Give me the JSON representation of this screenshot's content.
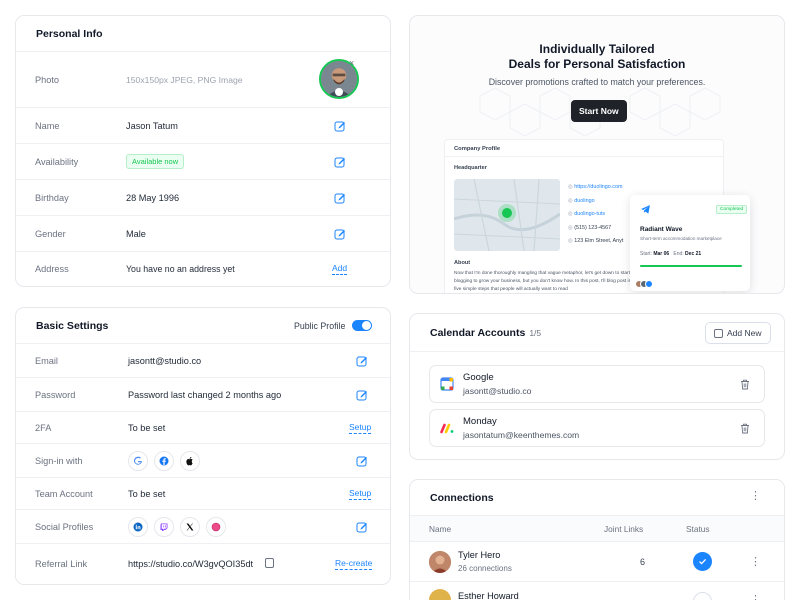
{
  "personal": {
    "title": "Personal Info",
    "photo_label": "Photo",
    "photo_hint": "150x150px JPEG, PNG Image",
    "name_label": "Name",
    "name_value": "Jason Tatum",
    "availability_label": "Availability",
    "availability_value": "Available now",
    "birthday_label": "Birthday",
    "birthday_value": "28 May 1996",
    "gender_label": "Gender",
    "gender_value": "Male",
    "address_label": "Address",
    "address_value": "You have no an address yet",
    "add_label": "Add"
  },
  "basic": {
    "title": "Basic Settings",
    "public_label": "Public Profile",
    "email_label": "Email",
    "email_value": "jasontt@studio.co",
    "password_label": "Password",
    "password_value": "Password last changed 2 months ago",
    "twofa_label": "2FA",
    "twofa_value": "To be set",
    "setup_label": "Setup",
    "signin_label": "Sign-in with",
    "team_label": "Team Account",
    "team_value": "To be set",
    "social_label": "Social Profiles",
    "referral_label": "Referral Link",
    "referral_value": "https://studio.co/W3gvQOI35dt",
    "recreate_label": "Re-create"
  },
  "promo": {
    "title_line1": "Individually Tailored",
    "title_line2": "Deals for Personal Satisfaction",
    "subtitle": "Discover promotions crafted to match your preferences.",
    "cta": "Start Now",
    "company_profile": "Company Profile",
    "headquarter": "Headquarter",
    "url": "https://duolingo.com",
    "handle1": "duolingo",
    "handle2": "duolingo-tuts",
    "phone": "(515) 123-4567",
    "street": "123 Elm Street, Anyt",
    "about": "About",
    "about_text": "Now that I'm done thoroughly mangling that vague metaphor, let's get down to start blogging to grow your business, but you don't know how. In this post, I'll blog post in five simple steps that people will actually want to read",
    "completed": "Completed",
    "project_name": "Radiant Wave",
    "project_desc": "Short-term accommodation marketplace",
    "start_label": "Start:",
    "start_value": "Mar 06",
    "end_label": "End:",
    "end_value": "Dec 21"
  },
  "calendar": {
    "title": "Calendar Accounts",
    "count": "1/5",
    "add_new": "Add New",
    "accounts": [
      {
        "name": "Google",
        "email": "jasontt@studio.co"
      },
      {
        "name": "Monday",
        "email": "jasontatum@keenthemes.com"
      }
    ]
  },
  "connections": {
    "title": "Connections",
    "col_name": "Name",
    "col_links": "Joint Links",
    "col_status": "Status",
    "rows": [
      {
        "name": "Tyler Hero",
        "sub": "26 connections",
        "links": "6"
      },
      {
        "name": "Esther Howard",
        "sub": "",
        "links": ""
      }
    ]
  },
  "colors": {
    "primary": "#1b84ff",
    "success": "#17c653",
    "dark": "#1f2229"
  }
}
